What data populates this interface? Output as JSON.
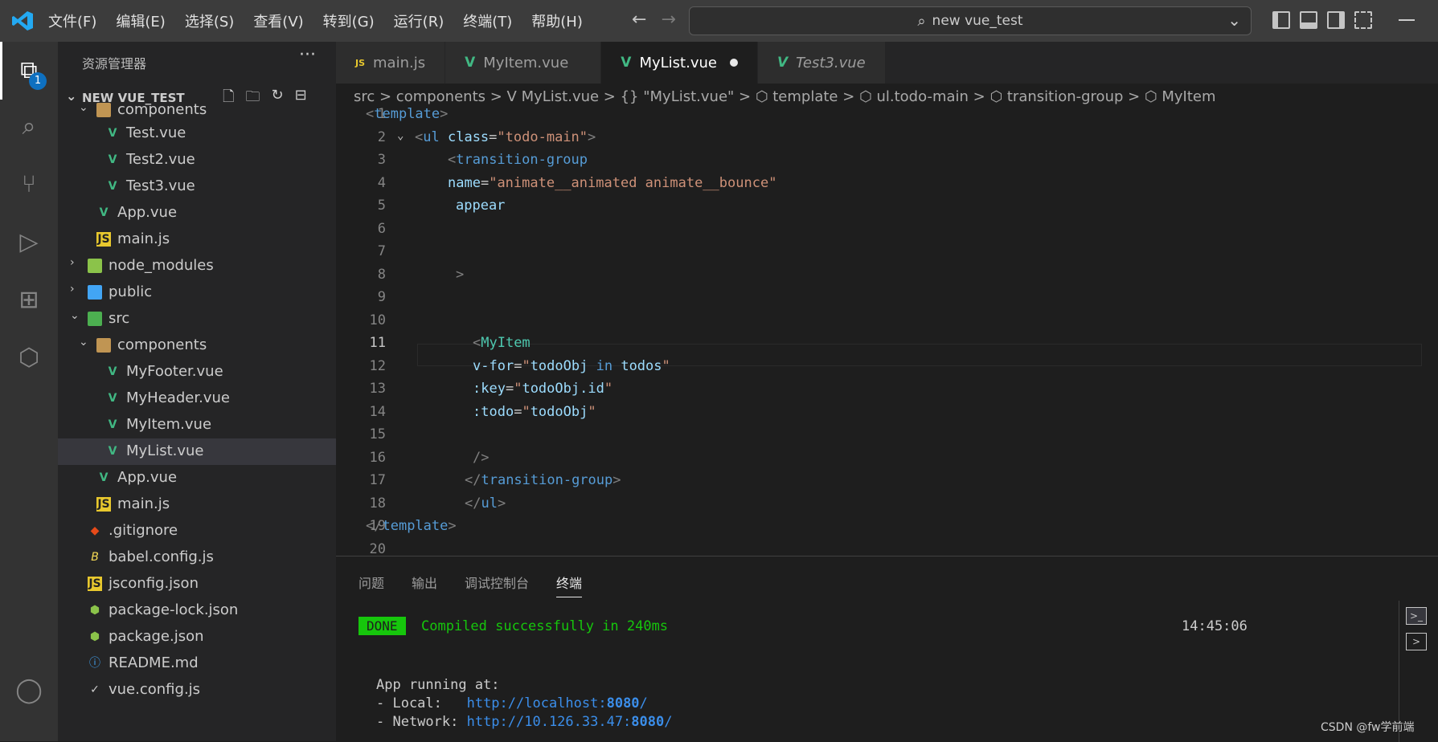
{
  "menu": [
    "文件(F)",
    "编辑(E)",
    "选择(S)",
    "查看(V)",
    "转到(G)",
    "运行(R)",
    "终端(T)",
    "帮助(H)"
  ],
  "search": {
    "text": "new vue_test"
  },
  "activity": {
    "badge": "1"
  },
  "explorer": {
    "title": "资源管理器",
    "project": "NEW VUE_TEST",
    "items": [
      {
        "label": "components",
        "type": "folder",
        "open": true
      },
      {
        "label": "Test.vue",
        "type": "vue"
      },
      {
        "label": "Test2.vue",
        "type": "vue"
      },
      {
        "label": "Test3.vue",
        "type": "vue"
      },
      {
        "label": "App.vue",
        "type": "vue"
      },
      {
        "label": "main.js",
        "type": "js"
      },
      {
        "label": "node_modules",
        "type": "folder",
        "open": false
      },
      {
        "label": "public",
        "type": "folder",
        "open": false
      },
      {
        "label": "src",
        "type": "folder",
        "open": true
      },
      {
        "label": "components",
        "type": "folder",
        "open": true
      },
      {
        "label": "MyFooter.vue",
        "type": "vue"
      },
      {
        "label": "MyHeader.vue",
        "type": "vue"
      },
      {
        "label": "MyItem.vue",
        "type": "vue"
      },
      {
        "label": "MyList.vue",
        "type": "vue",
        "selected": true
      },
      {
        "label": "App.vue",
        "type": "vue"
      },
      {
        "label": "main.js",
        "type": "js"
      },
      {
        "label": ".gitignore",
        "type": "git"
      },
      {
        "label": "babel.config.js",
        "type": "babel"
      },
      {
        "label": "jsconfig.json",
        "type": "js"
      },
      {
        "label": "package-lock.json",
        "type": "node"
      },
      {
        "label": "package.json",
        "type": "node"
      },
      {
        "label": "README.md",
        "type": "info"
      },
      {
        "label": "vue.config.js",
        "type": "cfg"
      }
    ]
  },
  "tabs": [
    {
      "label": "main.js",
      "icon": "JS"
    },
    {
      "label": "MyItem.vue",
      "icon": "V"
    },
    {
      "label": "MyList.vue",
      "icon": "V",
      "active": true,
      "modified": true
    },
    {
      "label": "Test3.vue",
      "icon": "V",
      "italic": true
    }
  ],
  "breadcrumb": "src > components > V MyList.vue > {} \"MyList.vue\" > ⬡ template > ⬡ ul.todo-main > ⬡ transition-group > ⬡ MyItem",
  "code": {
    "line_numbers": [
      "1",
      "2",
      "3",
      "4",
      "5",
      "6",
      "7",
      "8",
      "9",
      "10",
      "11",
      "12",
      "13",
      "14",
      "15",
      "16",
      "17",
      "18",
      "19",
      "20"
    ],
    "current_line": "11"
  },
  "panel": {
    "tabs": [
      "问题",
      "输出",
      "调试控制台",
      "终端"
    ],
    "active_tab": "终端",
    "done_label": "DONE",
    "compiled": "Compiled successfully in 240ms",
    "time": "14:45:06",
    "app_running": "App running at:",
    "local_label": "- Local:   ",
    "local_url_prefix": "http://localhost:",
    "local_port": "8080",
    "network_label": "- Network: ",
    "network_url_prefix": "http://10.126.33.47:",
    "network_port": "8080"
  },
  "watermark": "CSDN @fw学前端"
}
